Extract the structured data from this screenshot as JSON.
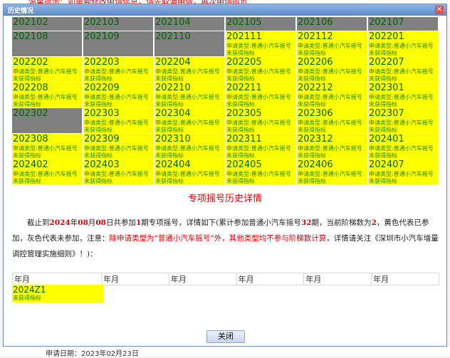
{
  "background": {
    "top_text": "温馨提示：如需要修改申请信息，请先取消申请，再次申请即可",
    "bottom_text": "申请日期：2023年02月23日"
  },
  "dialog": {
    "title": "历史情况",
    "close_symbol": "✕",
    "heading": "专项摇号历史详情",
    "desc": {
      "p1": "截止到",
      "year": "2024",
      "p2": "年",
      "month": "08",
      "p3": "月",
      "day": "08",
      "p4": "日共参加",
      "count": "1",
      "p5": "期专项摇号，详情如下(累计参加普通小汽车摇号",
      "total": "32",
      "p6": "期，当前阶梯数为",
      "step": "2",
      "p7": "，黄色代表已参加，灰色代表未参加，注意：",
      "warn": "除申请类型为“普通小汽车摇号”外，其他类型均不参与阶梯数计算",
      "p8": "，详情请关注《深圳市小汽车增量调控管理实施细则》！)："
    },
    "periods": [
      [
        {
          "code": "202102",
          "participated": false
        },
        {
          "code": "202103",
          "participated": false
        },
        {
          "code": "202104",
          "participated": false
        },
        {
          "code": "202105",
          "participated": false
        },
        {
          "code": "202106",
          "participated": false
        },
        {
          "code": "202107",
          "participated": false
        }
      ],
      [
        {
          "code": "202108",
          "participated": false
        },
        {
          "code": "202109",
          "participated": false
        },
        {
          "code": "202110",
          "participated": false
        },
        {
          "code": "202111",
          "participated": true
        },
        {
          "code": "202112",
          "participated": true
        },
        {
          "code": "202201",
          "participated": true
        }
      ],
      [
        {
          "code": "202202",
          "participated": true
        },
        {
          "code": "202203",
          "participated": true
        },
        {
          "code": "202204",
          "participated": true
        },
        {
          "code": "202205",
          "participated": true
        },
        {
          "code": "202206",
          "participated": true
        },
        {
          "code": "202207",
          "participated": true
        }
      ],
      [
        {
          "code": "202208",
          "participated": true
        },
        {
          "code": "202209",
          "participated": true
        },
        {
          "code": "202210",
          "participated": true
        },
        {
          "code": "202211",
          "participated": true
        },
        {
          "code": "202212",
          "participated": true
        },
        {
          "code": "202301",
          "participated": true
        }
      ],
      [
        {
          "code": "202302",
          "participated": false
        },
        {
          "code": "202303",
          "participated": true
        },
        {
          "code": "202304",
          "participated": true
        },
        {
          "code": "202305",
          "participated": true
        },
        {
          "code": "202306",
          "participated": true
        },
        {
          "code": "202307",
          "participated": true
        }
      ],
      [
        {
          "code": "202308",
          "participated": true
        },
        {
          "code": "202309",
          "participated": true
        },
        {
          "code": "202310",
          "participated": true
        },
        {
          "code": "202311",
          "participated": true
        },
        {
          "code": "202312",
          "participated": true
        },
        {
          "code": "202401",
          "participated": true
        }
      ],
      [
        {
          "code": "202402",
          "participated": true
        },
        {
          "code": "202403",
          "participated": true
        },
        {
          "code": "202404",
          "participated": true
        },
        {
          "code": "202405",
          "participated": true
        },
        {
          "code": "202406",
          "participated": true
        },
        {
          "code": "202407",
          "participated": true
        }
      ]
    ],
    "cell_type_text": "申请类型:普通小汽车摇号",
    "cell_result_text": "未获得指标",
    "history_headers": [
      "年月",
      "年月",
      "年月",
      "年月",
      "年月",
      "年月"
    ],
    "history_entry": {
      "code": "2024Z1",
      "result": "未获得指标"
    },
    "close_button": "关闭"
  },
  "colors": {
    "participated": "#ffff00",
    "not_participated": "#808080",
    "code_text": "#006400",
    "highlight": "#dd0000"
  }
}
